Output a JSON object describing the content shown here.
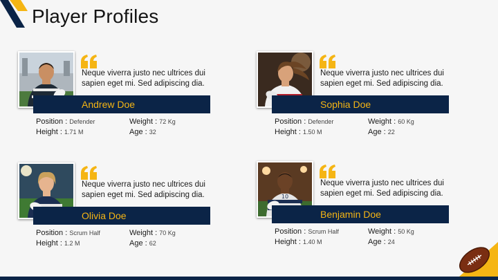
{
  "title": "Player Profiles",
  "colors": {
    "navy": "#0b2447",
    "gold": "#f5b514"
  },
  "icons": {
    "quote": "quote-icon",
    "logo": "corner-logo-icon",
    "ball": "rugby-ball-icon"
  },
  "players": [
    {
      "name": "Andrew Doe",
      "quote": "Neque viverra justo nec ultrices dui sapien eget mi. Sed adipiscing dia.",
      "position_label": "Position :",
      "position": "Defender",
      "height_label": "Height :",
      "height": "1.71 M",
      "weight_label": "Weight :",
      "weight": "72 Kg",
      "age_label": "Age :",
      "age": "32"
    },
    {
      "name": "Sophia Doe",
      "quote": "Neque viverra justo nec ultrices dui sapien eget mi. Sed adipiscing dia.",
      "position_label": "Position :",
      "position": "Defender",
      "height_label": "Height :",
      "height": "1.50 M",
      "weight_label": "Weight :",
      "weight": "60 Kg",
      "age_label": "Age :",
      "age": "22"
    },
    {
      "name": "Olivia Doe",
      "quote": "Neque viverra justo nec ultrices dui sapien eget mi. Sed adipiscing dia.",
      "position_label": "Position :",
      "position": "Scrum Half",
      "height_label": "Height :",
      "height": "1.2 M",
      "weight_label": "Weight :",
      "weight": "70 Kg",
      "age_label": "Age :",
      "age": "62"
    },
    {
      "name": "Benjamin Doe",
      "quote": "Neque viverra justo nec ultrices dui sapien eget mi. Sed adipiscing dia.",
      "position_label": "Position :",
      "position": "Scrum Half",
      "height_label": "Height :",
      "height": "1.40 M",
      "weight_label": "Weight :",
      "weight": "50 Kg",
      "age_label": "Age :",
      "age": "24"
    }
  ]
}
